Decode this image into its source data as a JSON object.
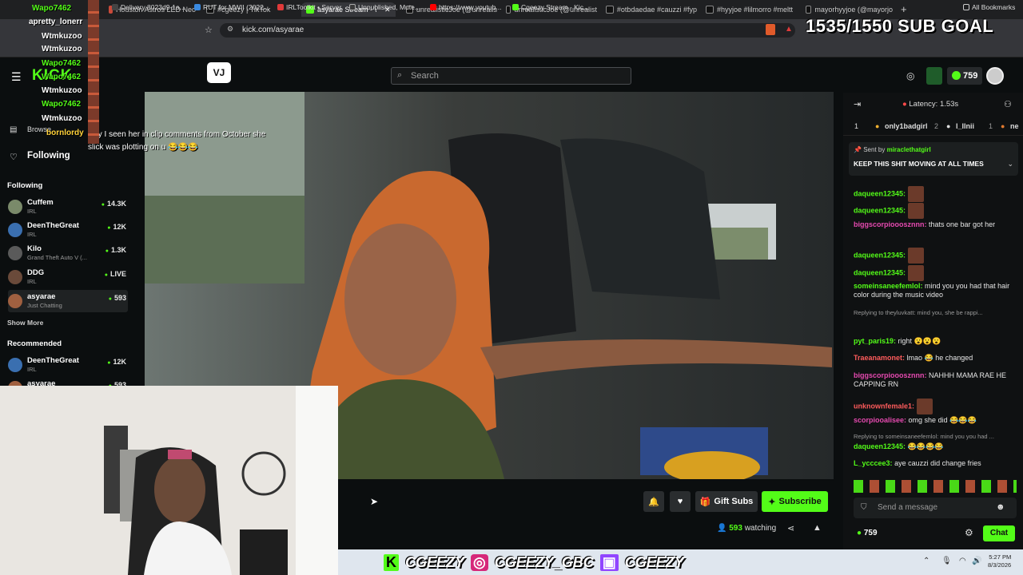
{
  "browser": {
    "tabs": [
      {
        "title": "Houston Astros LED Neo",
        "active": false
      },
      {
        "title": "#cgeezy | TikTok",
        "active": false
      },
      {
        "title": "asyarae Stream - \\",
        "active": true
      },
      {
        "title": "unrealisticJoe (@unrealis",
        "active": false
      },
      {
        "title": "unrealisticJoe (@unrealist",
        "active": false
      },
      {
        "title": "#otbdaedae #cauzzi #fyp",
        "active": false
      },
      {
        "title": "#hyyjoe #lilmorro #meltt",
        "active": false
      },
      {
        "title": "mayorhyyjoe (@mayorjo",
        "active": false
      }
    ],
    "url": "kick.com/asyarae",
    "bookmarks": [
      "Delivery 8023d9-1a...",
      "RUT for MWII (2022...",
      "IRLToolkit • Server",
      "Unpublished, Mute...",
      "https://www.youtub...",
      "Cgeezy Stream - Kic..."
    ],
    "all_bookmarks": "All Bookmarks"
  },
  "overlay": {
    "sub_goal": "1535/1550 SUB GOAL",
    "ticker_names": [
      "Wapo7462",
      "apretty_lonerr",
      "Wtmkuzoo",
      "Wtmkuzoo",
      "Wapo7462",
      "Wapo7462",
      "Wtmkuzoo",
      "Wapo7462",
      "Wtmkuzoo",
      "bornlordy"
    ],
    "clip_comment": "why I seen her in clip comments from October she slick was plotting on u 😂😂😂",
    "banner": [
      "CGEEZY",
      "CGEEZY_GBC",
      "CGEEZY"
    ]
  },
  "kick": {
    "logo": "KICK",
    "search_placeholder": "Search",
    "points_balance": "759",
    "browse": "Browse",
    "following_nav": "Following",
    "following_title": "Following",
    "following": [
      {
        "name": "Cuffem",
        "category": "IRL",
        "viewers": "14.3K",
        "color": "#7a8a6a"
      },
      {
        "name": "DeenTheGreat",
        "category": "IRL",
        "viewers": "12K",
        "color": "#3a6fb0"
      },
      {
        "name": "Kilo",
        "category": "Grand Theft Auto V (...",
        "viewers": "1.3K",
        "color": "#5a5a5a"
      },
      {
        "name": "DDG",
        "category": "IRL",
        "viewers": "LIVE",
        "color": "#6a4a3a"
      },
      {
        "name": "asyarae",
        "category": "Just Chatting",
        "viewers": "593",
        "color": "#a06040"
      }
    ],
    "show_more": "Show More",
    "recommended_title": "Recommended",
    "recommended": [
      {
        "name": "DeenTheGreat",
        "category": "IRL",
        "viewers": "12K",
        "color": "#3a6fb0"
      },
      {
        "name": "asyarae",
        "category": "",
        "viewers": "593",
        "color": "#a06040"
      }
    ],
    "gift_subs": "Gift Subs",
    "subscribe": "Subscribe",
    "watching_count": "593",
    "watching_label": "watching"
  },
  "chat": {
    "latency": "Latency: 1.53s",
    "leaderboard": [
      {
        "rank": "1",
        "name": "only1badgirl",
        "count": "2"
      },
      {
        "rank": "",
        "name": "l_llnii",
        "count": "1"
      },
      {
        "rank": "",
        "name": "ne",
        "count": ""
      }
    ],
    "pinned_by_label": "Sent by",
    "pinned_by": "miraclethatgirl",
    "pinned_msg": "KEEP THIS SHIT MOVING AT ALL TIMES",
    "messages": [
      {
        "user": "daqueen12345:",
        "color": "#53fc18",
        "text": "",
        "emote": true
      },
      {
        "user": "daqueen12345:",
        "color": "#53fc18",
        "text": "",
        "emote": true
      },
      {
        "user": "biggscorpiooosznnn:",
        "color": "#e64ab0",
        "text": "thats one bar got her",
        "emote": false
      },
      {
        "user": "daqueen12345:",
        "color": "#53fc18",
        "text": "",
        "emote": true
      },
      {
        "user": "daqueen12345:",
        "color": "#53fc18",
        "text": "",
        "emote": true
      },
      {
        "user": "someinsaneefemlol:",
        "color": "#53fc18",
        "text": "mind you you had that hair color during the music video",
        "emote": false
      },
      {
        "reply": "Replying to theyluvkatt: mind you, she be rappi..."
      },
      {
        "user": "pyt_paris19:",
        "color": "#53fc18",
        "text": "right 😮😮😮",
        "emote": false
      },
      {
        "user": "Traeanamonet:",
        "color": "#ff5c5c",
        "text": "lmao 😂 he changed",
        "emote": false
      },
      {
        "user": "biggscorpiooosznnn:",
        "color": "#e64ab0",
        "text": "NAHHH MAMA RAE HE CAPPING RN",
        "emote": false
      },
      {
        "user": "unknownfemale1:",
        "color": "#ff5c5c",
        "text": "",
        "emote": true
      },
      {
        "user": "scorpiooalisee:",
        "color": "#e64ab0",
        "text": "omg she did 😂😂😂",
        "emote": false
      },
      {
        "reply": "Replying to someinsaneefemlol: mind you you had ..."
      },
      {
        "user": "daqueen12345:",
        "color": "#53fc18",
        "text": "😂😂😂😂",
        "emote": false
      },
      {
        "user": "L_ycccee3:",
        "color": "#53fc18",
        "text": "aye cauzzi did change fries",
        "emote": false
      }
    ],
    "input_placeholder": "Send a message",
    "points": "759",
    "chat_button": "Chat"
  },
  "system": {
    "time": "5:27 PM",
    "date": "8/3/2026"
  },
  "colors": {
    "kick_green": "#53fc18",
    "background": "#0b0e0f"
  }
}
